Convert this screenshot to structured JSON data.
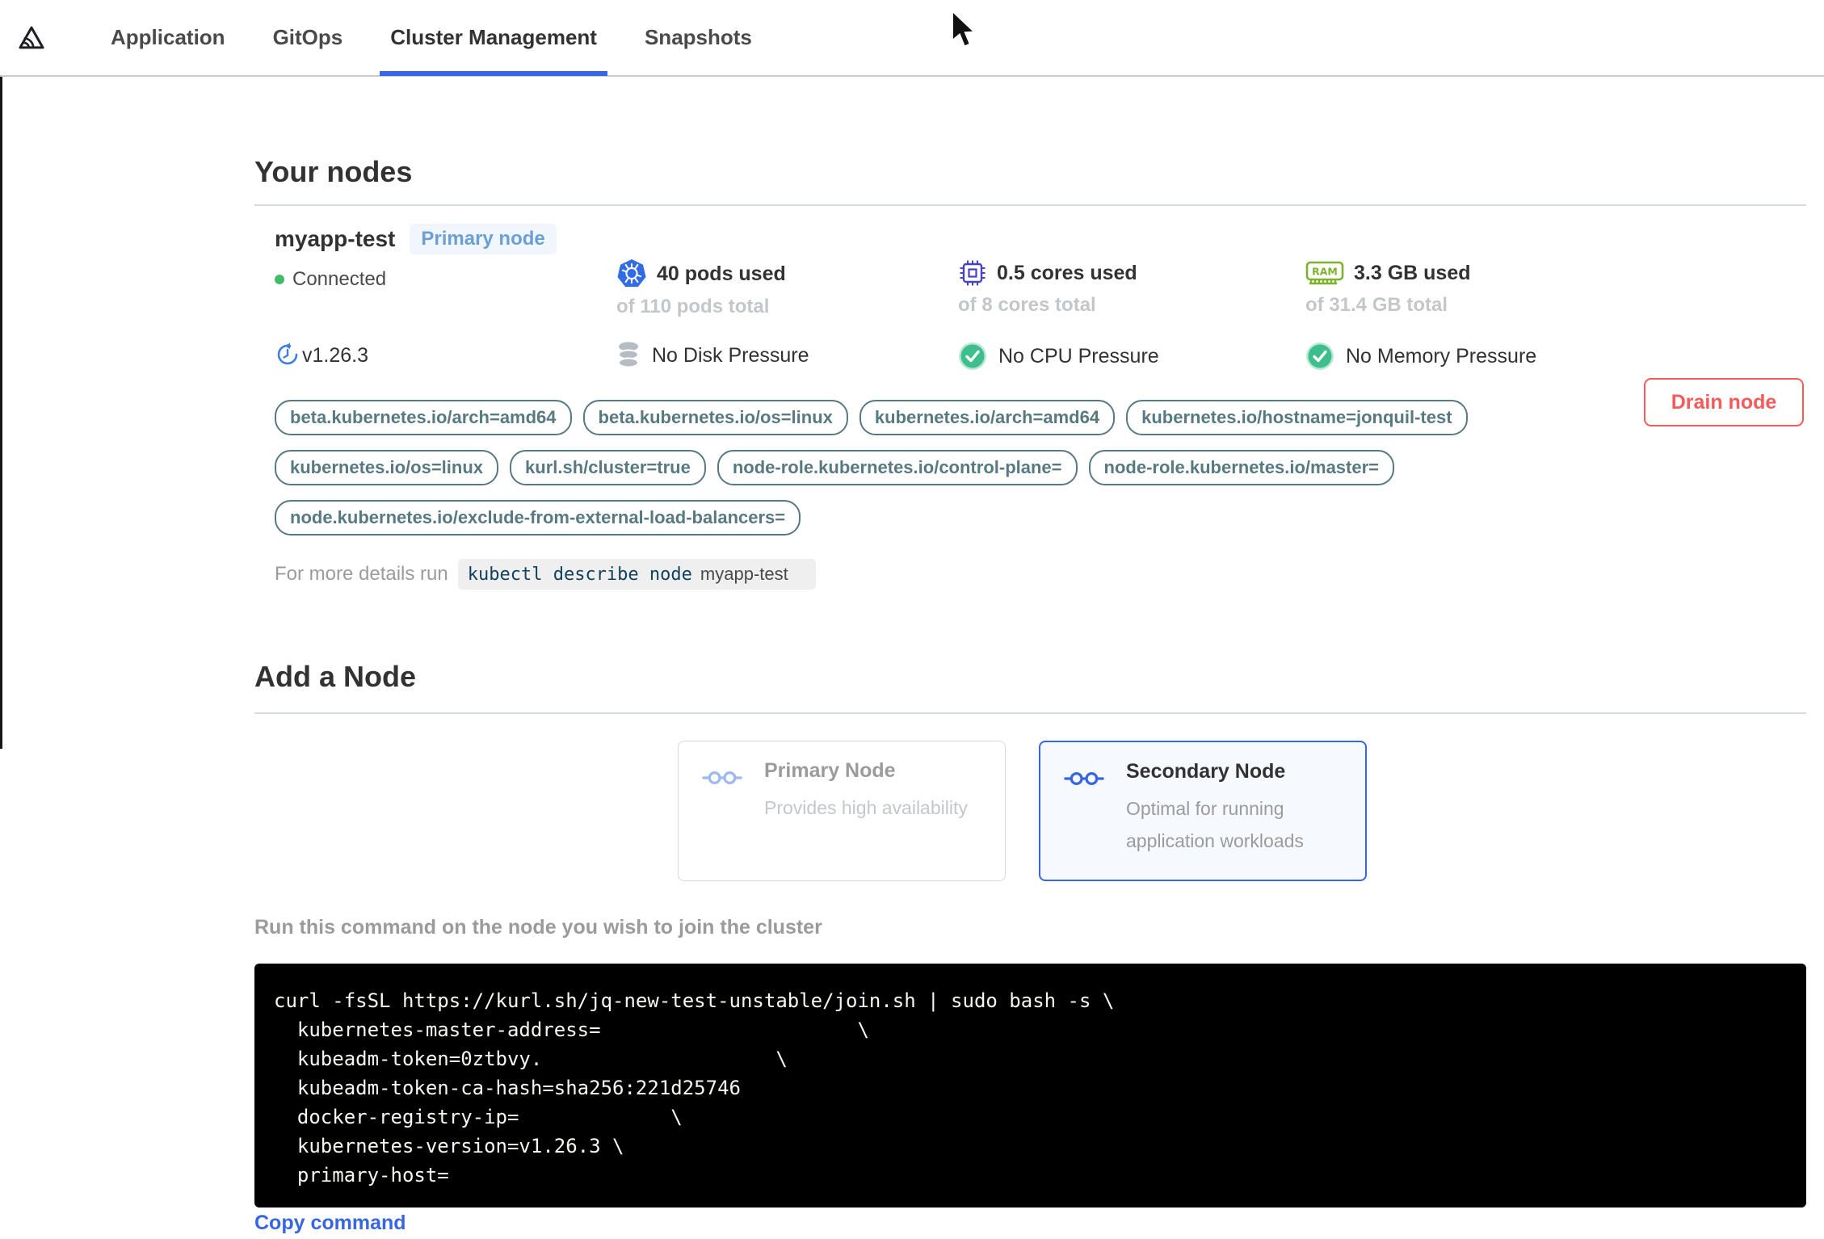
{
  "nav": {
    "tabs": [
      {
        "label": "Application"
      },
      {
        "label": "GitOps"
      },
      {
        "label": "Cluster Management"
      },
      {
        "label": "Snapshots"
      }
    ],
    "active_tab": "Cluster Management"
  },
  "your_nodes": {
    "title": "Your nodes",
    "node": {
      "name": "myapp-test",
      "badge": "Primary node",
      "status": "Connected",
      "version": "v1.26.3",
      "stats": [
        {
          "icon": "kubernetes-icon",
          "used": "40 pods used",
          "total": "of 110 pods total"
        },
        {
          "icon": "cpu-icon",
          "used": "0.5 cores used",
          "total": "of 8 cores total"
        },
        {
          "icon": "ram-icon",
          "used": "3.3 GB used",
          "total": "of 31.4 GB total"
        }
      ],
      "pressures": [
        {
          "icon": "disk-icon",
          "label": "No Disk Pressure"
        },
        {
          "icon": "check-icon",
          "label": "No CPU Pressure"
        },
        {
          "icon": "check-icon",
          "label": "No Memory Pressure"
        }
      ],
      "labels": [
        "beta.kubernetes.io/arch=amd64",
        "beta.kubernetes.io/os=linux",
        "kubernetes.io/arch=amd64",
        "kubernetes.io/hostname=jonquil-test",
        "kubernetes.io/os=linux",
        "kurl.sh/cluster=true",
        "node-role.kubernetes.io/control-plane=",
        "node-role.kubernetes.io/master=",
        "node.kubernetes.io/exclude-from-external-load-balancers="
      ],
      "details_prefix": "For more details run",
      "details_command": "kubectl describe node",
      "details_node": "myapp-test",
      "drain_button": "Drain node"
    }
  },
  "add_node": {
    "title": "Add a Node",
    "options": [
      {
        "title": "Primary Node",
        "description": "Provides high availability",
        "selected": false
      },
      {
        "title": "Secondary Node",
        "description": "Optimal for running application workloads",
        "selected": true
      }
    ],
    "instruction": "Run this command on the node you wish to join the cluster",
    "command_lines": [
      "curl -fsSL https://kurl.sh/jq-new-test-unstable/join.sh | sudo bash -s \\",
      "  kubernetes-master-address=                      \\",
      "  kubeadm-token=0ztbvy.                    \\",
      "  kubeadm-token-ca-hash=sha256:221d25746",
      "  docker-registry-ip=             \\",
      "  kubernetes-version=v1.26.3 \\",
      "  primary-host="
    ],
    "copy_label": "Copy command"
  },
  "colors": {
    "accent_blue": "#3866e0",
    "kubernetes_blue": "#326ce5",
    "cpu_purple": "#4744c4",
    "ram_green": "#7eb22d",
    "success_green": "#3dbe8c",
    "connected_green": "#44bb66",
    "danger_red": "#f65a5a",
    "label_teal": "#577981",
    "badge_blue": "#6c9fd6"
  }
}
